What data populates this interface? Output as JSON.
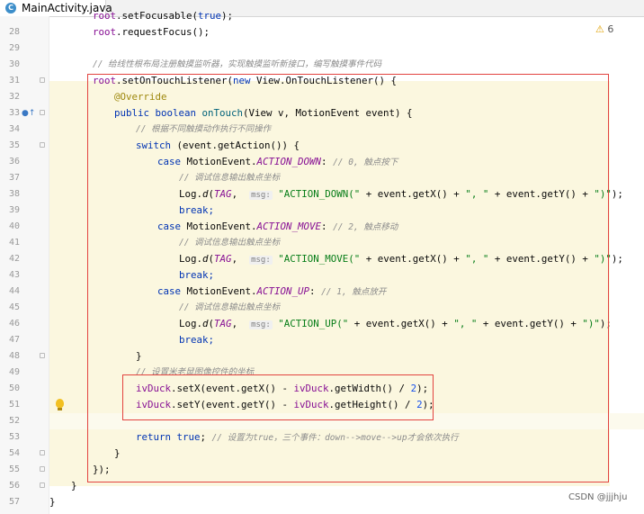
{
  "tab": {
    "file_name": "MainActivity.java",
    "icon_letter": "C"
  },
  "inspection": {
    "warning_count": "6"
  },
  "watermark": "CSDN @jjjhju",
  "lines": {
    "l27": "root.setFocusable(true);",
    "n28": "28",
    "n29": "29",
    "n30": "30",
    "n31": "31",
    "n32": "32",
    "n33": "33",
    "n34": "34",
    "n35": "35",
    "n36": "36",
    "n37": "37",
    "n38": "38",
    "n39": "39",
    "n40": "40",
    "n41": "41",
    "n42": "42",
    "n43": "43",
    "n44": "44",
    "n45": "45",
    "n46": "46",
    "n47": "47",
    "n48": "48",
    "n49": "49",
    "n50": "50",
    "n51": "51",
    "n52": "52",
    "n53": "53",
    "n54": "54",
    "n55": "55",
    "n56": "56",
    "n57": "57",
    "c30": "// 给线性根布局注册触摸监听器，实现触摸监听新接口，编写触摸事件代码",
    "c34": "// 根据不同触摸动作执行不同操作",
    "c36_cm": "// 0, 触点按下",
    "c37": "// 调试信息输出触点坐标",
    "c40_cm": "// 2, 触点移动",
    "c41": "// 调试信息输出触点坐标",
    "c44_cm": "// 1, 触点放开",
    "c45": "// 调试信息输出触点坐标",
    "c49": "// 设置米老鼠图像控件的坐标",
    "c53_cm": "// 设置为true，三个事件：down-->move-->up才会依次执行",
    "hint_msg": "msg:",
    "str38": "\"ACTION_DOWN(\"",
    "str42": "\"ACTION_MOVE(\"",
    "str46": "\"ACTION_UP(\"",
    "str_sep": "\", \"",
    "str_close": "\")\""
  }
}
